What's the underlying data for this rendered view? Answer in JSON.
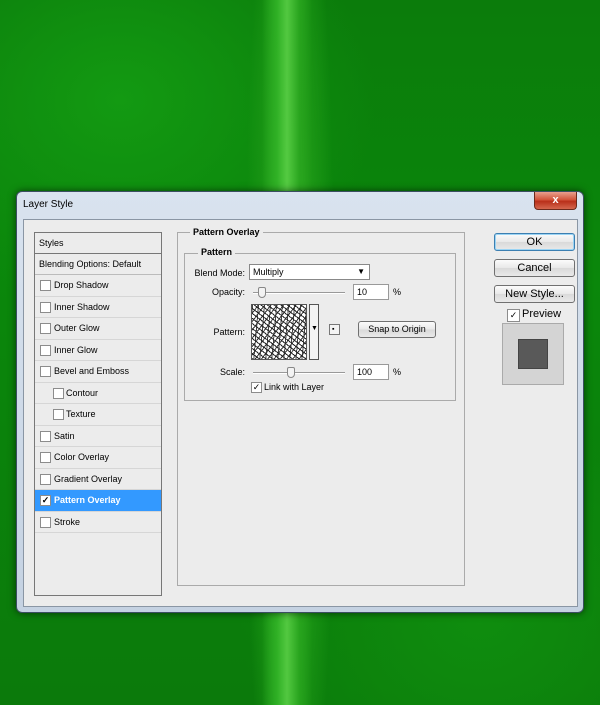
{
  "window": {
    "title": "Layer Style",
    "close_label": "x"
  },
  "styles_panel": {
    "header": "Styles",
    "blending": "Blending Options: Default",
    "items": [
      {
        "label": "Drop Shadow",
        "checked": false
      },
      {
        "label": "Inner Shadow",
        "checked": false
      },
      {
        "label": "Outer Glow",
        "checked": false
      },
      {
        "label": "Inner Glow",
        "checked": false
      },
      {
        "label": "Bevel and Emboss",
        "checked": false
      },
      {
        "label": "Contour",
        "checked": false
      },
      {
        "label": "Texture",
        "checked": false
      },
      {
        "label": "Satin",
        "checked": false
      },
      {
        "label": "Color Overlay",
        "checked": false
      },
      {
        "label": "Gradient Overlay",
        "checked": false
      },
      {
        "label": "Pattern Overlay",
        "checked": true,
        "selected": true
      },
      {
        "label": "Stroke",
        "checked": false
      }
    ]
  },
  "pattern_overlay": {
    "section_title": "Pattern Overlay",
    "group_title": "Pattern",
    "blend_mode_label": "Blend Mode:",
    "blend_mode_value": "Multiply",
    "opacity_label": "Opacity:",
    "opacity_value": "10",
    "opacity_unit": "%",
    "opacity_fraction": 0.1,
    "pattern_label": "Pattern:",
    "snap_button": "Snap to Origin",
    "scale_label": "Scale:",
    "scale_value": "100",
    "scale_unit": "%",
    "scale_fraction": 0.33,
    "link_label": "Link with Layer",
    "link_checked": true
  },
  "buttons": {
    "ok": "OK",
    "cancel": "Cancel",
    "new_style": "New Style...",
    "preview_label": "Preview",
    "preview_checked": true
  },
  "colors": {
    "selection": "#3399ff",
    "dialog_bg": "#ececec"
  }
}
